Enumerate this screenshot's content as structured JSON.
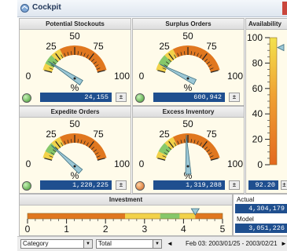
{
  "window": {
    "title": "Cockpit"
  },
  "gauges": [
    {
      "title": "Potential Stockouts",
      "value": "24,155",
      "status": "green",
      "needle_value": 12,
      "unit": "%"
    },
    {
      "title": "Surplus Orders",
      "value": "600,942",
      "status": "green",
      "needle_value": 8,
      "unit": "%"
    },
    {
      "title": "Expedite Orders",
      "value": "1,228,225",
      "status": "green",
      "needle_value": 18,
      "unit": "%"
    },
    {
      "title": "Excess Inventory",
      "value": "1,319,288",
      "status": "orange",
      "needle_value": 48,
      "unit": "%"
    }
  ],
  "gauge_scale": {
    "ticks": [
      "0",
      "25",
      "50",
      "75",
      "100"
    ]
  },
  "availability": {
    "title": "Availability",
    "value": "92.20",
    "ticks": [
      "100",
      "80",
      "60",
      "40",
      "20",
      "0"
    ],
    "level": 92.2
  },
  "investment": {
    "title": "Investment",
    "ticks": [
      "0",
      "1",
      "2",
      "3",
      "4",
      "5"
    ],
    "marker_value": 4.3,
    "actual_label": "Actual",
    "actual_value": "4,304,179",
    "model_label": "Model",
    "model_value": "3,051,226"
  },
  "controls": {
    "expand_symbol": "±",
    "category_select": "Category",
    "total_select": "Total",
    "prev_symbol": "◄",
    "next_symbol": "►",
    "period_text": "Feb 03: 2003/01/25 - 2003/02/21"
  }
}
